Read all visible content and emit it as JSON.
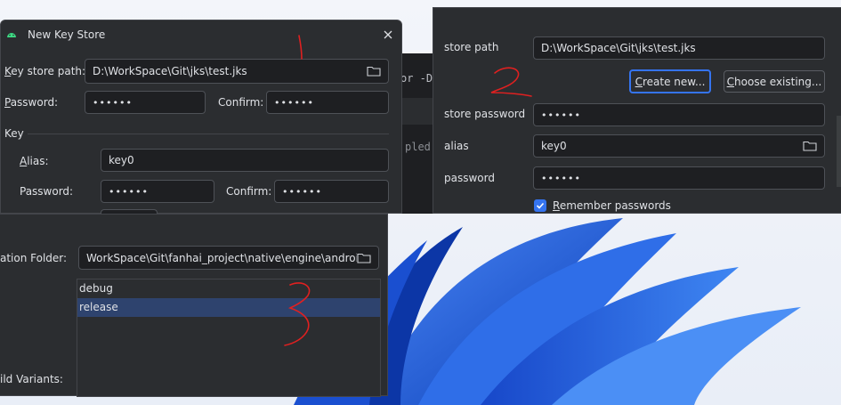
{
  "dialog1": {
    "title": "New Key Store",
    "keystore_path_label": "Key store path:",
    "keystore_path_value": "D:\\WorkSpace\\Git\\jks\\test.jks",
    "password_label": "Password:",
    "password_value": "••••••",
    "confirm_label": "Confirm:",
    "confirm_value": "••••••",
    "key_section_label": "Key",
    "alias_label": "Alias:",
    "alias_value": "key0",
    "key_password_label": "Password:",
    "key_password_value": "••••••",
    "key_confirm_label": "Confirm:",
    "key_confirm_value": "••••••"
  },
  "background_editor": {
    "fragment1": "or -D",
    "fragment2": "pled"
  },
  "dialog2": {
    "keystore_path_label": "store path",
    "keystore_path_value": "D:\\WorkSpace\\Git\\jks\\test.jks",
    "create_new_label": "Create new...",
    "choose_existing_label": "Choose existing...",
    "keystore_password_label": "store password",
    "keystore_password_value": "••••••",
    "alias_label": "alias",
    "alias_value": "key0",
    "key_password_label": "password",
    "key_password_value": "••••••",
    "remember_label": "Remember passwords"
  },
  "dialog3": {
    "destination_label": "ation Folder:",
    "destination_value": "WorkSpace\\Git\\fanhai_project\\native\\engine\\android\\app",
    "variants": [
      "debug",
      "release"
    ],
    "selected_variant": "release",
    "build_variants_label": "ild Variants:"
  },
  "annotations": [
    "1",
    "2",
    "3"
  ],
  "colors": {
    "panel_bg": "#2b2d30",
    "field_bg": "#1e1f22",
    "accent": "#3574f0",
    "selection": "#2e436e",
    "annotation_red": "#e02020"
  }
}
